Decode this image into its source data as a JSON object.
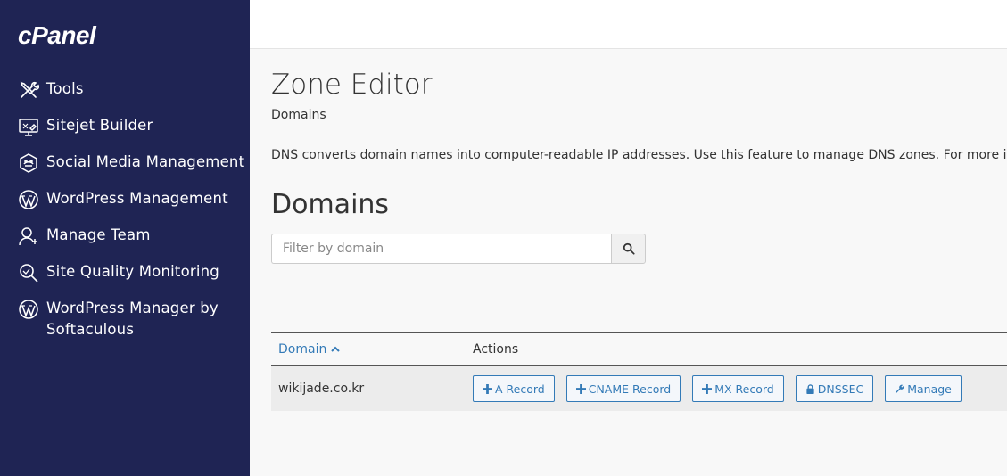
{
  "sidebar": {
    "logo": "cPanel",
    "items": [
      {
        "label": "Tools",
        "icon": "tools-icon"
      },
      {
        "label": "Sitejet Builder",
        "icon": "sitejet-icon"
      },
      {
        "label": "Social Media Management",
        "icon": "social-media-icon"
      },
      {
        "label": "WordPress Management",
        "icon": "wordpress-icon"
      },
      {
        "label": "Manage Team",
        "icon": "team-icon"
      },
      {
        "label": "Site Quality Monitoring",
        "icon": "magnifier-icon"
      },
      {
        "label": "WordPress Manager by Softaculous",
        "icon": "wordpress-icon"
      }
    ],
    "background": "#1f2454"
  },
  "page": {
    "title": "Zone Editor",
    "breadcrumb": "Domains",
    "description": "DNS converts domain names into computer-readable IP addresses. Use this feature to manage DNS zones. For more information",
    "section_title": "Domains"
  },
  "search": {
    "placeholder": "Filter by domain"
  },
  "table": {
    "headers": {
      "domain": "Domain",
      "actions": "Actions"
    },
    "rows": [
      {
        "domain": "wikijade.co.kr"
      }
    ],
    "actions": {
      "a_record": "A Record",
      "cname_record": "CNAME Record",
      "mx_record": "MX Record",
      "dnssec": "DNSSEC",
      "manage": "Manage"
    }
  },
  "colors": {
    "accent": "#337ab7",
    "sidebar": "#1f2454"
  }
}
